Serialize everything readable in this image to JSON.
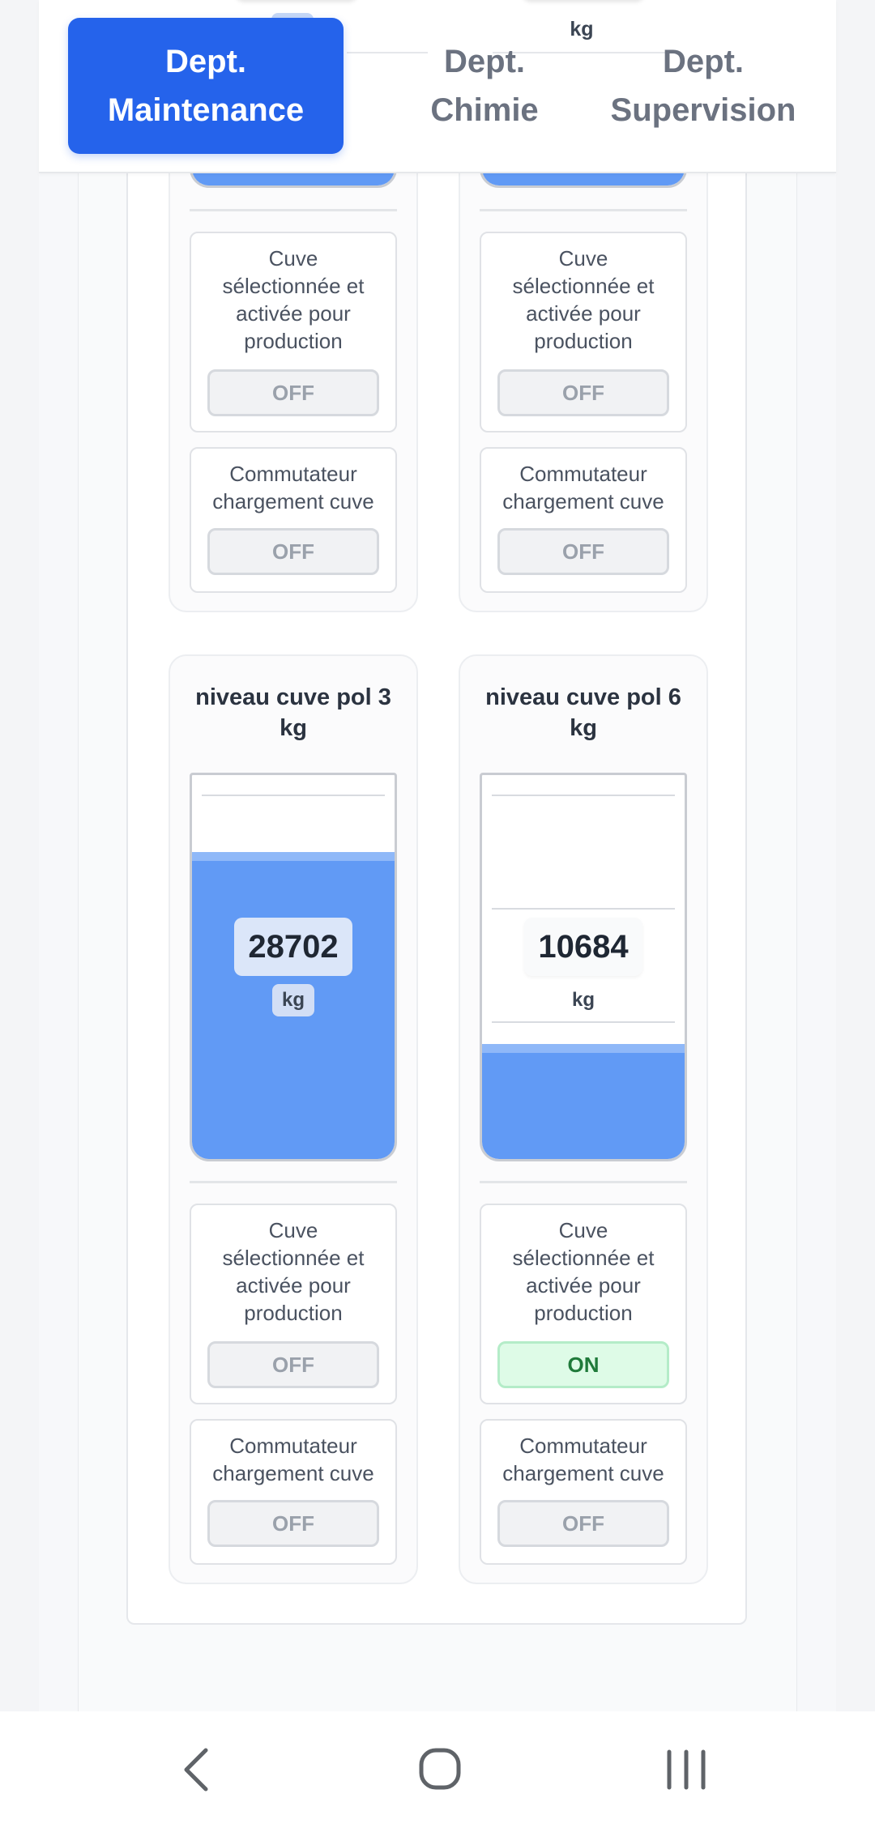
{
  "header": {
    "peek_units": [
      "kg",
      "kg"
    ],
    "tabs": [
      {
        "line1": "Dept.",
        "line2": "Maintenance",
        "active": true
      },
      {
        "line1": "Dept.",
        "line2": "Chimie",
        "active": false
      },
      {
        "line1": "Dept.",
        "line2": "Supervision",
        "active": false
      }
    ]
  },
  "upper_tanks": [
    {
      "controls": [
        {
          "label": "Cuve sélectionnée et activée pour production",
          "state": "OFF"
        },
        {
          "label": "Commutateur chargement cuve",
          "state": "OFF"
        }
      ]
    },
    {
      "controls": [
        {
          "label": "Cuve sélectionnée et activée pour production",
          "state": "OFF"
        },
        {
          "label": "Commutateur chargement cuve",
          "state": "OFF"
        }
      ]
    }
  ],
  "tanks": [
    {
      "title": "niveau cuve pol 3 kg",
      "value": "28702",
      "unit": "kg",
      "fill_fraction": 0.8,
      "controls": [
        {
          "label": "Cuve sélectionnée et activée pour production",
          "state": "OFF"
        },
        {
          "label": "Commutateur chargement cuve",
          "state": "OFF"
        }
      ]
    },
    {
      "title": "niveau cuve pol 6 kg",
      "value": "10684",
      "unit": "kg",
      "fill_fraction": 0.3,
      "controls": [
        {
          "label": "Cuve sélectionnée et activée pour production",
          "state": "ON"
        },
        {
          "label": "Commutateur chargement cuve",
          "state": "OFF"
        }
      ]
    }
  ],
  "colors": {
    "tab_active": "#2563eb",
    "tank_fill": "#619af5",
    "toggle_on_bg": "#defbe7",
    "toggle_on_text": "#1f7a3a",
    "toggle_off_text": "#9aa1ab"
  },
  "system_nav": {
    "icons": [
      "back-icon",
      "home-icon",
      "recent-apps-icon"
    ]
  }
}
